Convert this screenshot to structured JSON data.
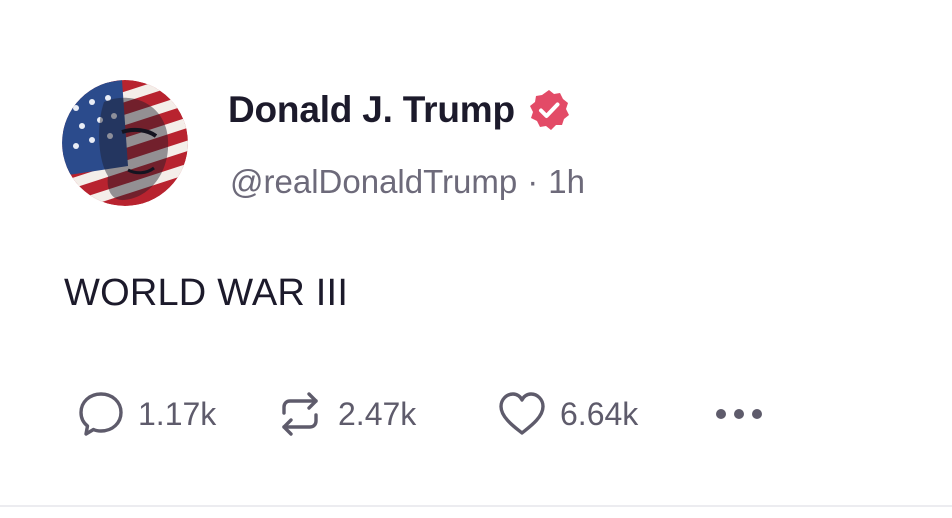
{
  "post": {
    "author": {
      "display_name": "Donald J. Trump",
      "verified": true,
      "verified_icon": "verified-badge-icon",
      "handle": "@realDonaldTrump",
      "separator": "·",
      "time": "1h",
      "avatar_icon": "user-avatar"
    },
    "text": "WORLD WAR III",
    "actions": {
      "reply": {
        "icon": "reply-bubble-icon",
        "count": "1.17k"
      },
      "repost": {
        "icon": "repost-icon",
        "count": "2.47k"
      },
      "like": {
        "icon": "heart-icon",
        "count": "6.64k"
      },
      "more": {
        "icon": "more-dots-icon"
      }
    }
  },
  "colors": {
    "text_primary": "#1c1a2b",
    "text_secondary": "#6d6a7a",
    "action_gray": "#5e5b6b",
    "verified_red": "#e34b67",
    "divider": "#ececf0"
  }
}
